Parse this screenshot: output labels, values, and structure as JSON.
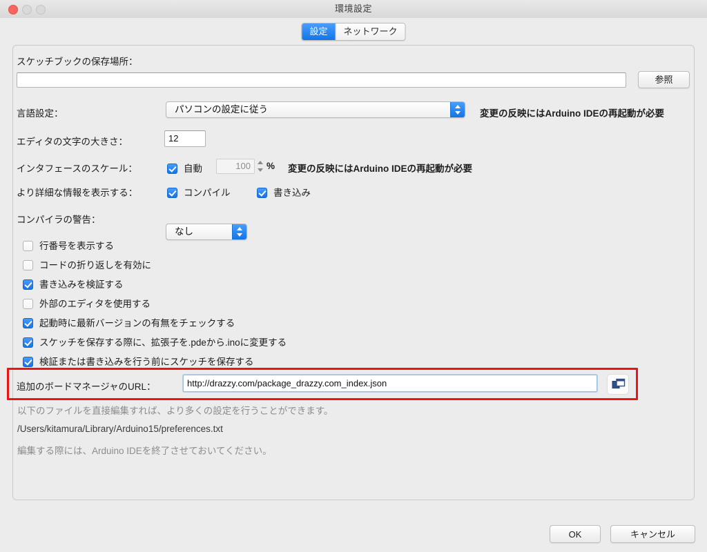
{
  "window": {
    "title": "環境設定",
    "traffic_lights": [
      "close",
      "minimize",
      "zoom"
    ]
  },
  "tabs": [
    {
      "label": "設定",
      "active": true
    },
    {
      "label": "ネットワーク",
      "active": false
    }
  ],
  "form": {
    "sketchbook": {
      "label": "スケッチブックの保存場所：",
      "value": "",
      "browse_label": "参照"
    },
    "language": {
      "label": "言語設定：",
      "value": "パソコンの設定に従う",
      "note": "変更の反映にはArduino IDEの再起動が必要"
    },
    "editor_font_size": {
      "label": "エディタの文字の大きさ：",
      "value": "12"
    },
    "interface_scale": {
      "label": "インタフェースのスケール：",
      "auto_label": "自動",
      "auto_checked": true,
      "value": "100",
      "unit": "%",
      "note": "変更の反映にはArduino IDEの再起動が必要"
    },
    "verbose": {
      "label": "より詳細な情報を表示する：",
      "compile_label": "コンパイル",
      "compile_checked": true,
      "upload_label": "書き込み",
      "upload_checked": true
    },
    "compiler_warnings": {
      "label": "コンパイラの警告：",
      "value": "なし"
    },
    "checkboxes": [
      {
        "label": "行番号を表示する",
        "checked": false
      },
      {
        "label": "コードの折り返しを有効に",
        "checked": false
      },
      {
        "label": "書き込みを検証する",
        "checked": true
      },
      {
        "label": "外部のエディタを使用する",
        "checked": false
      },
      {
        "label": "起動時に最新バージョンの有無をチェックする",
        "checked": true
      },
      {
        "label": "スケッチを保存する際に、拡張子を.pdeから.inoに変更する",
        "checked": true
      },
      {
        "label": "検証または書き込みを行う前にスケッチを保存する",
        "checked": true
      }
    ],
    "board_manager_url": {
      "label": "追加のボードマネージャのURL：",
      "value": "http://drazzy.com/package_drazzy.com_index.json",
      "copy_icon": "copy-windows-icon",
      "highlight_color": "#ef1313"
    },
    "footer_notes": [
      "以下のファイルを直接編集すれば、より多くの設定を行うことができます。",
      "/Users/kitamura/Library/Arduino15/preferences.txt",
      "編集する際には、Arduino IDEを終了させておいてください。"
    ]
  },
  "buttons": {
    "ok": "OK",
    "cancel": "キャンセル"
  },
  "colors": {
    "accent": "#1175e8",
    "highlight": "#ef1313",
    "background": "#ececec"
  }
}
